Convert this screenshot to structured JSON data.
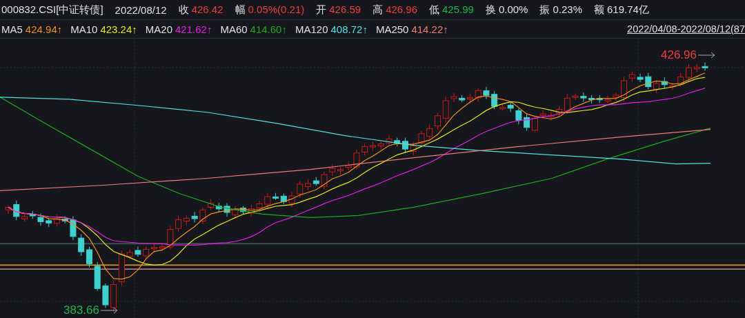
{
  "quote": {
    "code": "000832.CSI[中证转债]",
    "date": "2022/08/12",
    "fields": [
      {
        "label": "收",
        "value": "426.42",
        "color": "#f03c3c"
      },
      {
        "label": "幅",
        "value": "0.05%(0.21)",
        "color": "#f03c3c"
      },
      {
        "label": "开",
        "value": "426.59",
        "color": "#f03c3c"
      },
      {
        "label": "高",
        "value": "426.96",
        "color": "#f03c3c"
      },
      {
        "label": "低",
        "value": "425.99",
        "color": "#1eb450"
      },
      {
        "label": "换",
        "value": "0.00%",
        "color": "#e0e0e0"
      },
      {
        "label": "振",
        "value": "0.23%",
        "color": "#e0e0e0"
      },
      {
        "label": "额",
        "value": "619.74亿",
        "color": "#e0e0e0"
      }
    ]
  },
  "moving_averages": [
    {
      "label": "MA5",
      "value": "424.94↑",
      "color": "#f0901a"
    },
    {
      "label": "MA10",
      "value": "423.24↑",
      "color": "#e6e61e"
    },
    {
      "label": "MA20",
      "value": "421.62↑",
      "color": "#e61ee6"
    },
    {
      "label": "MA60",
      "value": "414.60↑",
      "color": "#1eaa1e"
    },
    {
      "label": "MA120",
      "value": "408.72↑",
      "color": "#50e0e6"
    },
    {
      "label": "MA250",
      "value": "414.22↑",
      "color": "#f07878"
    }
  ],
  "range": "2022/04/08-2022/08/12(87",
  "chart": {
    "high_label": "426.96",
    "low_label": "383.66"
  }
}
